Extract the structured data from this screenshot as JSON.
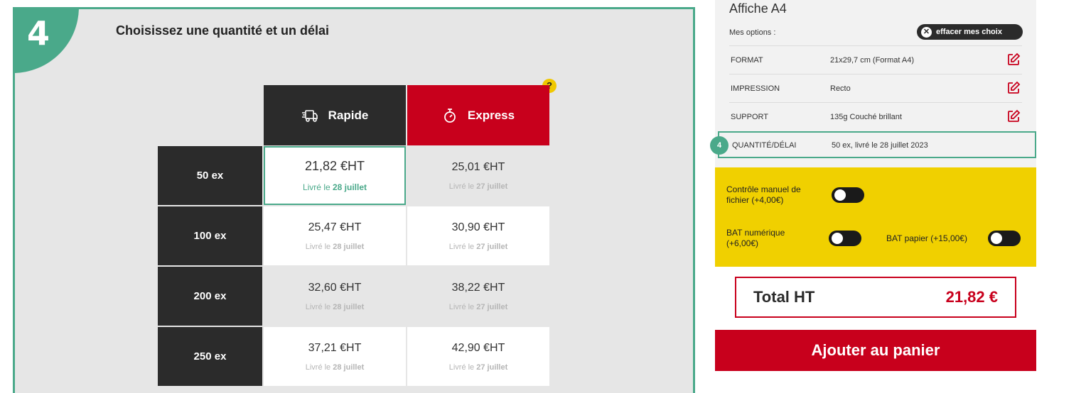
{
  "step": {
    "number": "4",
    "title": "Choisissez une quantité et un délai",
    "help_label": "?",
    "columns": [
      {
        "label": "Rapide",
        "icon": "truck-icon"
      },
      {
        "label": "Express",
        "icon": "stopwatch-icon"
      }
    ],
    "rows": [
      {
        "qty": "50 ex",
        "rapide": {
          "price": "21,82 €HT",
          "deliv_prefix": "Livré le ",
          "deliv_date": "28 juillet"
        },
        "express": {
          "price": "25,01 €HT",
          "deliv_prefix": "Livré le ",
          "deliv_date": "27 juillet"
        }
      },
      {
        "qty": "100 ex",
        "rapide": {
          "price": "25,47 €HT",
          "deliv_prefix": "Livré le ",
          "deliv_date": "28 juillet"
        },
        "express": {
          "price": "30,90 €HT",
          "deliv_prefix": "Livré le ",
          "deliv_date": "27 juillet"
        }
      },
      {
        "qty": "200 ex",
        "rapide": {
          "price": "32,60 €HT",
          "deliv_prefix": "Livré le ",
          "deliv_date": "28 juillet"
        },
        "express": {
          "price": "38,22 €HT",
          "deliv_prefix": "Livré le ",
          "deliv_date": "27 juillet"
        }
      },
      {
        "qty": "250 ex",
        "rapide": {
          "price": "37,21 €HT",
          "deliv_prefix": "Livré le ",
          "deliv_date": "28 juillet"
        },
        "express": {
          "price": "42,90 €HT",
          "deliv_prefix": "Livré le ",
          "deliv_date": "27 juillet"
        }
      }
    ]
  },
  "summary": {
    "product_title": "Affiche A4",
    "options_label": "Mes options :",
    "clear_label": "effacer mes choix",
    "options": [
      {
        "key": "FORMAT",
        "value": "21x29,7 cm (Format A4)"
      },
      {
        "key": "IMPRESSION",
        "value": "Recto"
      },
      {
        "key": "SUPPORT",
        "value": "135g Couché brillant"
      }
    ],
    "active_option": {
      "step": "4",
      "key": "QUANTITÉ/DÉLAI",
      "value": "50 ex, livré le 28 juillet 2023"
    },
    "extras": {
      "manual_check": "Contrôle manuel de fichier (+4,00€)",
      "bat_num": "BAT numérique (+6,00€)",
      "bat_paper": "BAT papier (+15,00€)"
    },
    "total_label": "Total HT",
    "total_value": "21,82 €",
    "cart_label": "Ajouter au panier"
  },
  "colors": {
    "accent": "#4aa98a",
    "brand_red": "#c8001c",
    "dark": "#2b2b2b",
    "yellow": "#f0d000"
  }
}
